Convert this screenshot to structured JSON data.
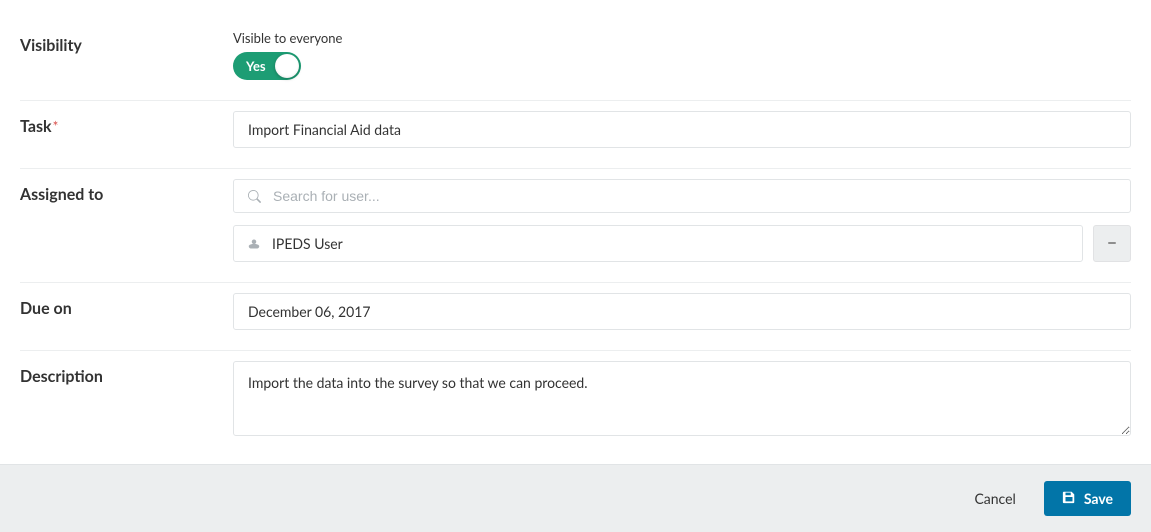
{
  "visibility": {
    "label": "Visibility",
    "sub_label": "Visible to everyone",
    "toggle_state": "Yes"
  },
  "task": {
    "label": "Task",
    "required": true,
    "value": "Import Financial Aid data"
  },
  "assigned_to": {
    "label": "Assigned to",
    "search_placeholder": "Search for user...",
    "assigned_user": "IPEDS User"
  },
  "due_on": {
    "label": "Due on",
    "value": "December 06, 2017"
  },
  "description": {
    "label": "Description",
    "value": "Import the data into the survey so that we can proceed."
  },
  "footer": {
    "cancel_label": "Cancel",
    "save_label": "Save"
  },
  "colors": {
    "toggle_on": "#1d9d74",
    "primary_button": "#0275a8"
  }
}
